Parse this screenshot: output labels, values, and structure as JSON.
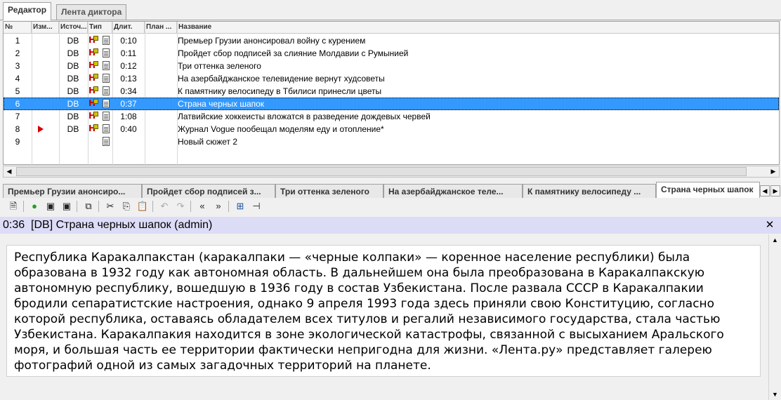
{
  "top_tabs": [
    {
      "label": "Редактор"
    },
    {
      "label": "Лента диктора"
    }
  ],
  "columns": {
    "num": "№",
    "mod": "Изм...",
    "src": "Источ...",
    "type": "Тип",
    "dur": "Длит.",
    "plan": "План ...",
    "name": "Название"
  },
  "rows": [
    {
      "num": "1",
      "src": "DB",
      "dur": "0:10",
      "name": "Премьер Грузии анонсировал войну с курением"
    },
    {
      "num": "2",
      "src": "DB",
      "dur": "0:11",
      "name": "Пройдет сбор подписей за слияние Молдавии с Румынией"
    },
    {
      "num": "3",
      "src": "DB",
      "dur": "0:12",
      "name": "Три оттенка зеленого"
    },
    {
      "num": "4",
      "src": "DB",
      "dur": "0:13",
      "name": "На азербайджанское телевидение вернут худсоветы"
    },
    {
      "num": "5",
      "src": "DB",
      "dur": "0:34",
      "name": "К памятнику велосипеду в Тбилиси принесли цветы"
    },
    {
      "num": "6",
      "src": "DB",
      "dur": "0:37",
      "name": "Страна черных шапок"
    },
    {
      "num": "7",
      "src": "DB",
      "dur": "1:08",
      "name": "Латвийские хоккеисты вложатся в разведение дождевых червей"
    },
    {
      "num": "8",
      "src": "DB",
      "dur": "0:40",
      "name": "Журнал Vogue пообещал моделям еду и отопление*"
    },
    {
      "num": "9",
      "src": "",
      "dur": "",
      "name": "Новый сюжет 2"
    }
  ],
  "selected_row": 6,
  "flagged_row": 8,
  "story_tabs": [
    {
      "label": "Премьер Грузии анонсиро..."
    },
    {
      "label": "Пройдет сбор подписей з..."
    },
    {
      "label": "Три оттенка зеленого"
    },
    {
      "label": "На азербайджанское теле..."
    },
    {
      "label": "К памятнику велосипеду ..."
    },
    {
      "label": "Страна черных шапок"
    }
  ],
  "story_header": "0:36  [DB] Страна черных шапок (admin)",
  "story_text": "Республика Каракалпакстан (каракалпаки — «черные колпаки» — коренное население республики) была образована в 1932 году как автономная область. В дальнейшем она была преобразована в Каракалпакскую автономную республику, вошедшую в 1936 году в состав Узбекистана. После развала СССР в Каракалпакии бродили сепаратистские настроения, однако 9 апреля 1993 года здесь приняли свою Конституцию, согласно которой республика, оставаясь обладателем всех титулов и регалий независимого государства, стала частью Узбекистана. Каракалпакия находится в зоне экологической катастрофы, связанной с высыханием Аральского моря, и большая часть ее территории фактически непригодна для жизни. «Лента.ру» представляет галерею фотографий одной из самых загадочных территорий на планете.",
  "icons": {
    "toolbar": [
      "new-document-icon",
      "approve-icon",
      "save-icon",
      "save-all-icon",
      "copy-story-icon",
      "cut-icon",
      "copy-icon",
      "paste-icon",
      "undo-icon",
      "redo-icon",
      "prev-icon",
      "next-icon",
      "layout-icon",
      "pin-icon"
    ]
  },
  "colors": {
    "selection": "#3399ff",
    "header_band": "#dcdcf7",
    "flag": "#d40000"
  }
}
